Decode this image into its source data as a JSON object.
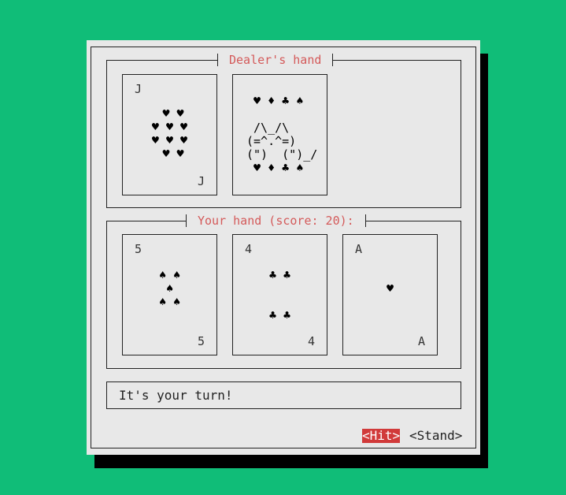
{
  "dealer": {
    "title": "Dealer's hand",
    "cards": [
      {
        "rank": "J",
        "suit": "hearts",
        "pips": " ♥ ♥\n♥ ♥ ♥\n♥ ♥ ♥\n ♥ ♥"
      },
      {
        "face_down": true,
        "art": " ♥ ♦ ♣ ♠\n\n /\\_/\\\n(=^.^=)\n(\")  (\")_/\n ♥ ♦ ♣ ♠"
      }
    ]
  },
  "player": {
    "title": "Your hand (score: 20):",
    "cards": [
      {
        "rank": "5",
        "suit": "spades",
        "pips": "♠ ♠\n♠\n♠ ♠"
      },
      {
        "rank": "4",
        "suit": "clubs",
        "pips": "♣ ♣\n\n\n♣ ♣"
      },
      {
        "rank": "A",
        "suit": "hearts",
        "pips": "♥"
      }
    ]
  },
  "status": "It's your turn!",
  "buttons": {
    "hit": "<Hit>",
    "stand": "<Stand>"
  },
  "colors": {
    "background": "#10bd78",
    "accent": "#d45a5a",
    "button_active": "#d13a3a",
    "dialog": "#e8e8e8"
  }
}
